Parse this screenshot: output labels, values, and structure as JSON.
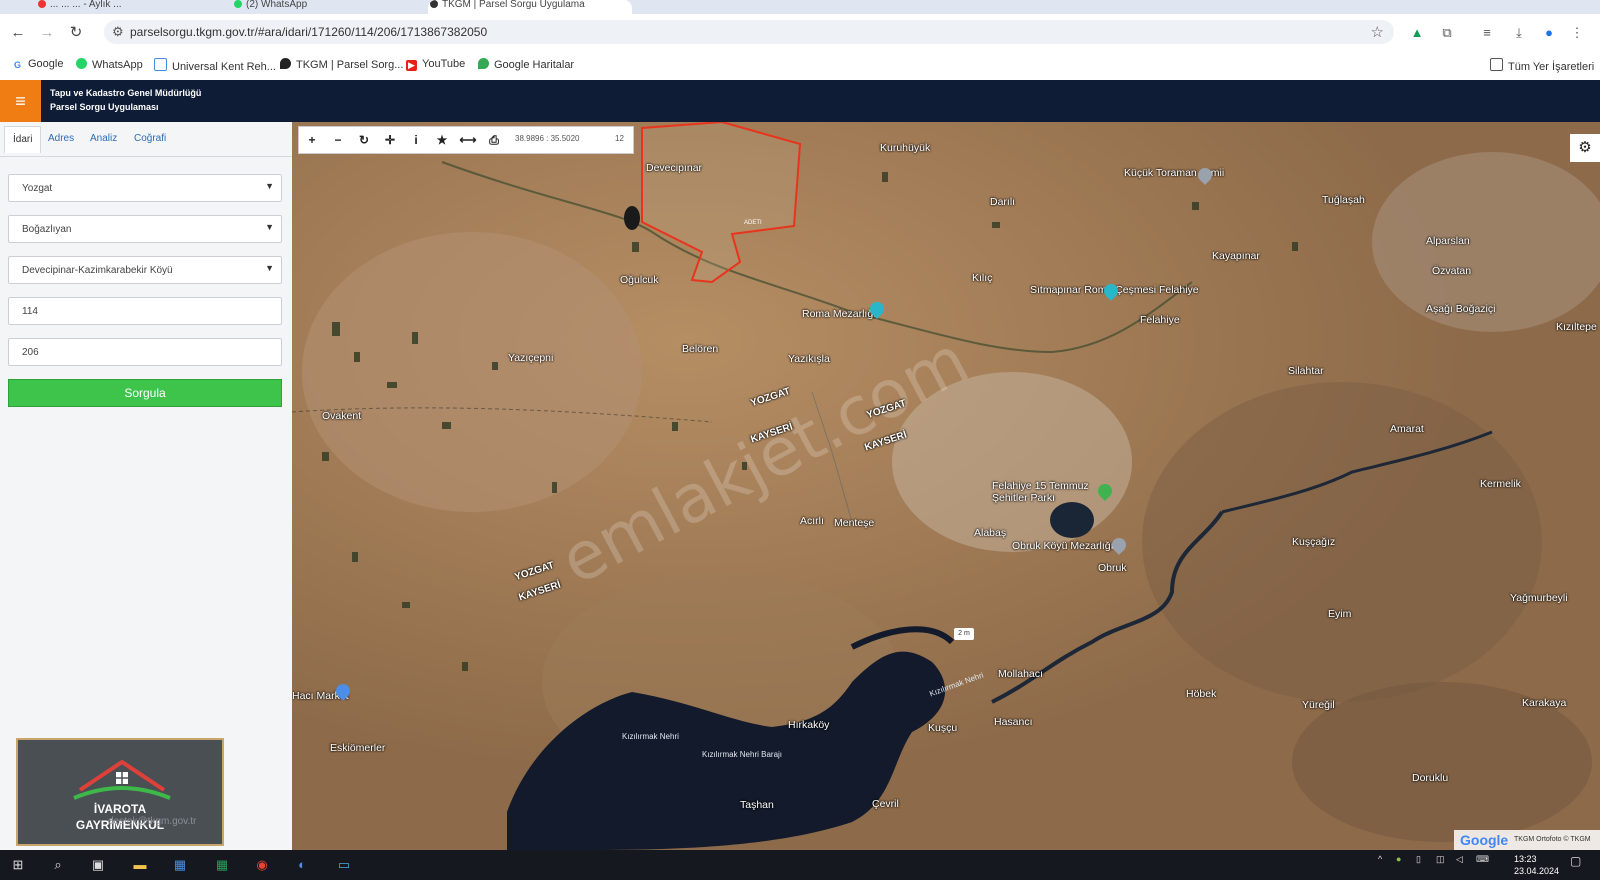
{
  "browser": {
    "tabs": [
      {
        "label": "... ... ... - Aylık ..."
      },
      {
        "label": "(2) WhatsApp"
      },
      {
        "label": "TKGM | Parsel Sorgu Uygulama"
      }
    ],
    "url": "parselsorgu.tkgm.gov.tr/#ara/idari/171260/114/206/1713867382050",
    "bookmarks": [
      {
        "label": "Google",
        "icon": "google-icon"
      },
      {
        "label": "WhatsApp",
        "icon": "whatsapp-icon"
      },
      {
        "label": "Universal Kent Reh...",
        "icon": "page-icon"
      },
      {
        "label": "TKGM | Parsel Sorg...",
        "icon": "location-pin-icon"
      },
      {
        "label": "YouTube",
        "icon": "youtube-icon"
      },
      {
        "label": "Google Haritalar",
        "icon": "maps-pin-icon"
      }
    ],
    "all_bookmarks": "Tüm Yer İşaretleri"
  },
  "app": {
    "title_line1": "Tapu ve Kadastro Genel Müdürlüğü",
    "title_line2": "Parsel Sorgu Uygulaması",
    "accent": "#f07d14",
    "header_bg": "#0e1c36"
  },
  "sidebar": {
    "tabs": [
      "İdari",
      "Adres",
      "Analiz",
      "Coğrafi"
    ],
    "province": "Yozgat",
    "district": "Boğazlıyan",
    "neighborhood": "Devecipinar-Kazimkarabekir Köyü",
    "block": "114",
    "parcel": "206",
    "submit": "Sorgula",
    "submit_color": "#3ec44b",
    "email_faint": "destek@tkgm.gov.tr"
  },
  "logo": {
    "line1": "İVAROTA",
    "line2": "GAYRİMENKUL"
  },
  "map": {
    "coords": "38.9896 : 35.5020",
    "zoom": "12",
    "scale_label": "2 m",
    "parcel_label": "ADETI",
    "watermark": "emlakjet.com",
    "attribution": "TKGM Ortofoto © TKGM",
    "google": "Google",
    "places": [
      "Devecipınar",
      "Kuruhüyük",
      "Küçük Toraman camii",
      "Darılı",
      "Tuğlaşah",
      "Alparslan",
      "Özvatan",
      "Kayapınar",
      "Aşağı Boğaziçi",
      "Kızıltepe",
      "Oğulcuk",
      "Kılıç",
      "Sıtmapınar Roma Çeşmesi Felahiye",
      "Felahiye",
      "Roma Mezarlığı",
      "Yazıçepni",
      "Belören",
      "Yazıkışla",
      "Silahtar",
      "Ovakent",
      "Amarat",
      "Kermelik",
      "Felahiye 15 Temmuz Şehitler Parkı",
      "Acırlı",
      "Menteşe",
      "Alabaş",
      "Obruk Köyü Mezarlığı",
      "Obruk",
      "Kuşçağız",
      "Eyim",
      "Yağmurbeyli",
      "Mollahacı",
      "Hacı Market",
      "Eskiömerler",
      "Hırkaköy",
      "Kuşçu",
      "Hasancı",
      "Höbek",
      "Yüreğil",
      "Karakaya",
      "Doruklu",
      "Taşhan",
      "Çevril"
    ],
    "boundaries": [
      "YOZGAT",
      "KAYSERİ"
    ],
    "waters": [
      "Kızılırmak Nehri",
      "Kızılırmak Nehri Barajı",
      "Kızılırmak Nehri"
    ]
  },
  "taskbar": {
    "time": "13:23",
    "date": "23.04.2024"
  }
}
